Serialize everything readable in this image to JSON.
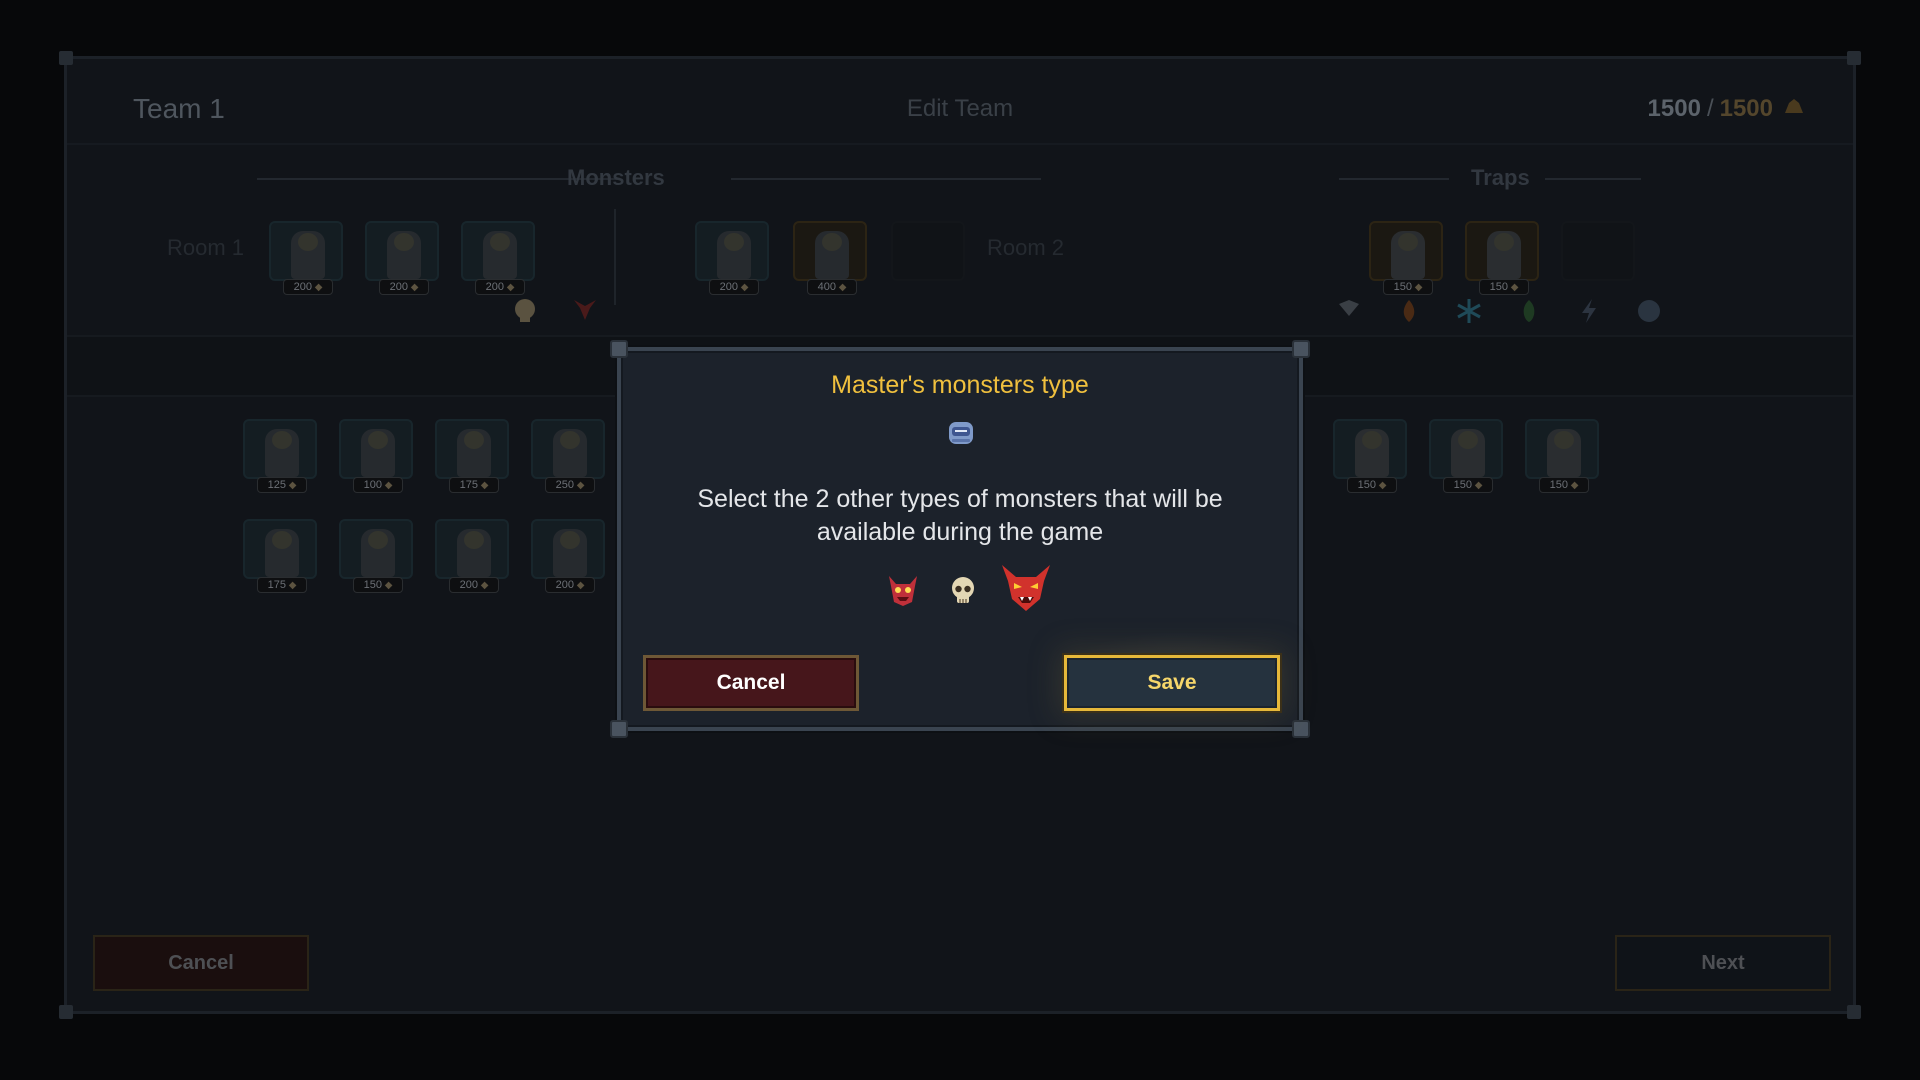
{
  "editor": {
    "team_name": "Team 1",
    "title": "Edit Team",
    "budget_used": "1500",
    "budget_sep": "/",
    "budget_max": "1500",
    "monsters_label": "Monsters",
    "traps_label": "Traps",
    "room1_label": "Room 1",
    "room2_label": "Room 2",
    "room1_costs": [
      "200",
      "200",
      "200"
    ],
    "room2_costs": [
      "200",
      "400"
    ],
    "trap_costs": [
      "150",
      "150"
    ],
    "grid_row1_costs": [
      "125",
      "100",
      "175",
      "250"
    ],
    "grid_row2_costs": [
      "175",
      "150",
      "200",
      "200"
    ],
    "trap_grid_costs": [
      "150",
      "150",
      "150"
    ],
    "cancel_label": "Cancel",
    "next_label": "Next"
  },
  "modal": {
    "title": "Master's monsters type",
    "description": "Select the 2 other types of monsters that will be available during the game",
    "master_type_icon": "robot-helmet-icon",
    "type_options": [
      "demon-icon",
      "skull-icon",
      "devil-icon"
    ],
    "cancel_label": "Cancel",
    "save_label": "Save"
  },
  "colors": {
    "title_gold": "#f0c03e",
    "save_border": "#e6b83a",
    "cancel_bg": "#46161b",
    "modal_bg": "#1c222b"
  }
}
